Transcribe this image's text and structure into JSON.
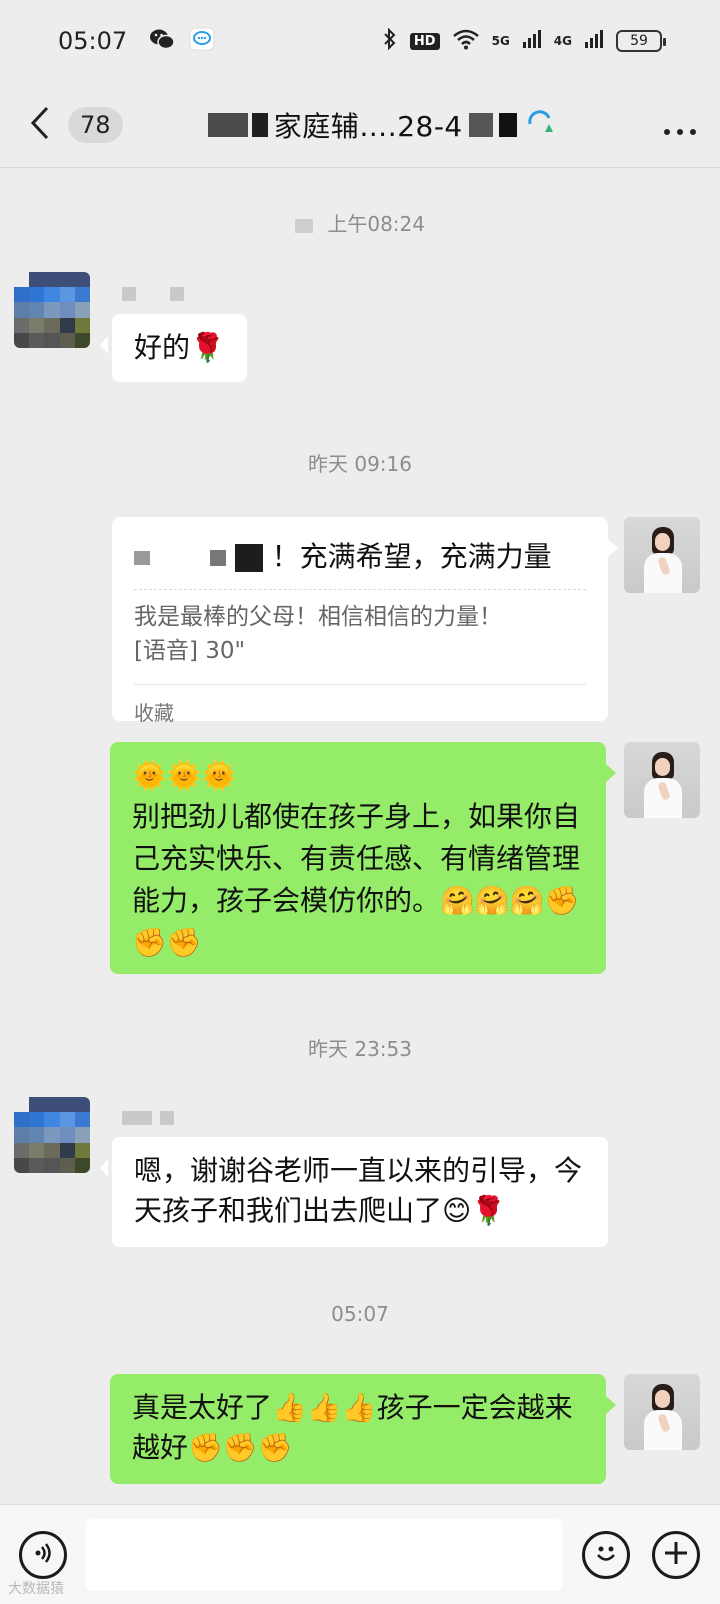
{
  "status_bar": {
    "time": "05:07",
    "hd_label": "HD",
    "net_5g": "5G",
    "net_4g": "4G",
    "battery": "59"
  },
  "header": {
    "unread_count": "78",
    "title_visible": "家庭辅….28-4"
  },
  "messages": {
    "ts1": "上午08:24",
    "msg1": "好的🌹",
    "ts2": "昨天 09:16",
    "fav_title_suffix": "！充满希望，充满力量",
    "fav_line1": "我是最棒的父母！相信相信的力量！",
    "fav_line2": "[语音] 30\"",
    "fav_footer": "收藏",
    "msg3_emoji_row": "🌞🌞🌞",
    "msg3_text": "别把劲儿都使在孩子身上，如果你自己充实快乐、有责任感、有情绪管理能力，孩子会模仿你的。🤗🤗🤗✊✊✊",
    "ts3": "昨天 23:53",
    "msg4": "嗯，谢谢谷老师一直以来的引导，今天孩子和我们出去爬山了😊🌹",
    "ts4": "05:07",
    "msg5": "真是太好了👍👍👍孩子一定会越来越好✊✊✊"
  },
  "watermark": "大数据猿",
  "colors": {
    "background": "#ededed",
    "sent_bubble": "#95ec69",
    "received_bubble": "#ffffff",
    "timestamp_text": "#8d8d8d"
  },
  "icons": {
    "status": [
      "wechat-icon",
      "chat-bubble-icon",
      "bluetooth-icon",
      "wifi-icon",
      "signal-icon",
      "battery-icon"
    ],
    "header": [
      "back-arrow-icon",
      "more-icon"
    ],
    "input": [
      "voice-icon",
      "emoji-icon",
      "plus-icon"
    ]
  }
}
